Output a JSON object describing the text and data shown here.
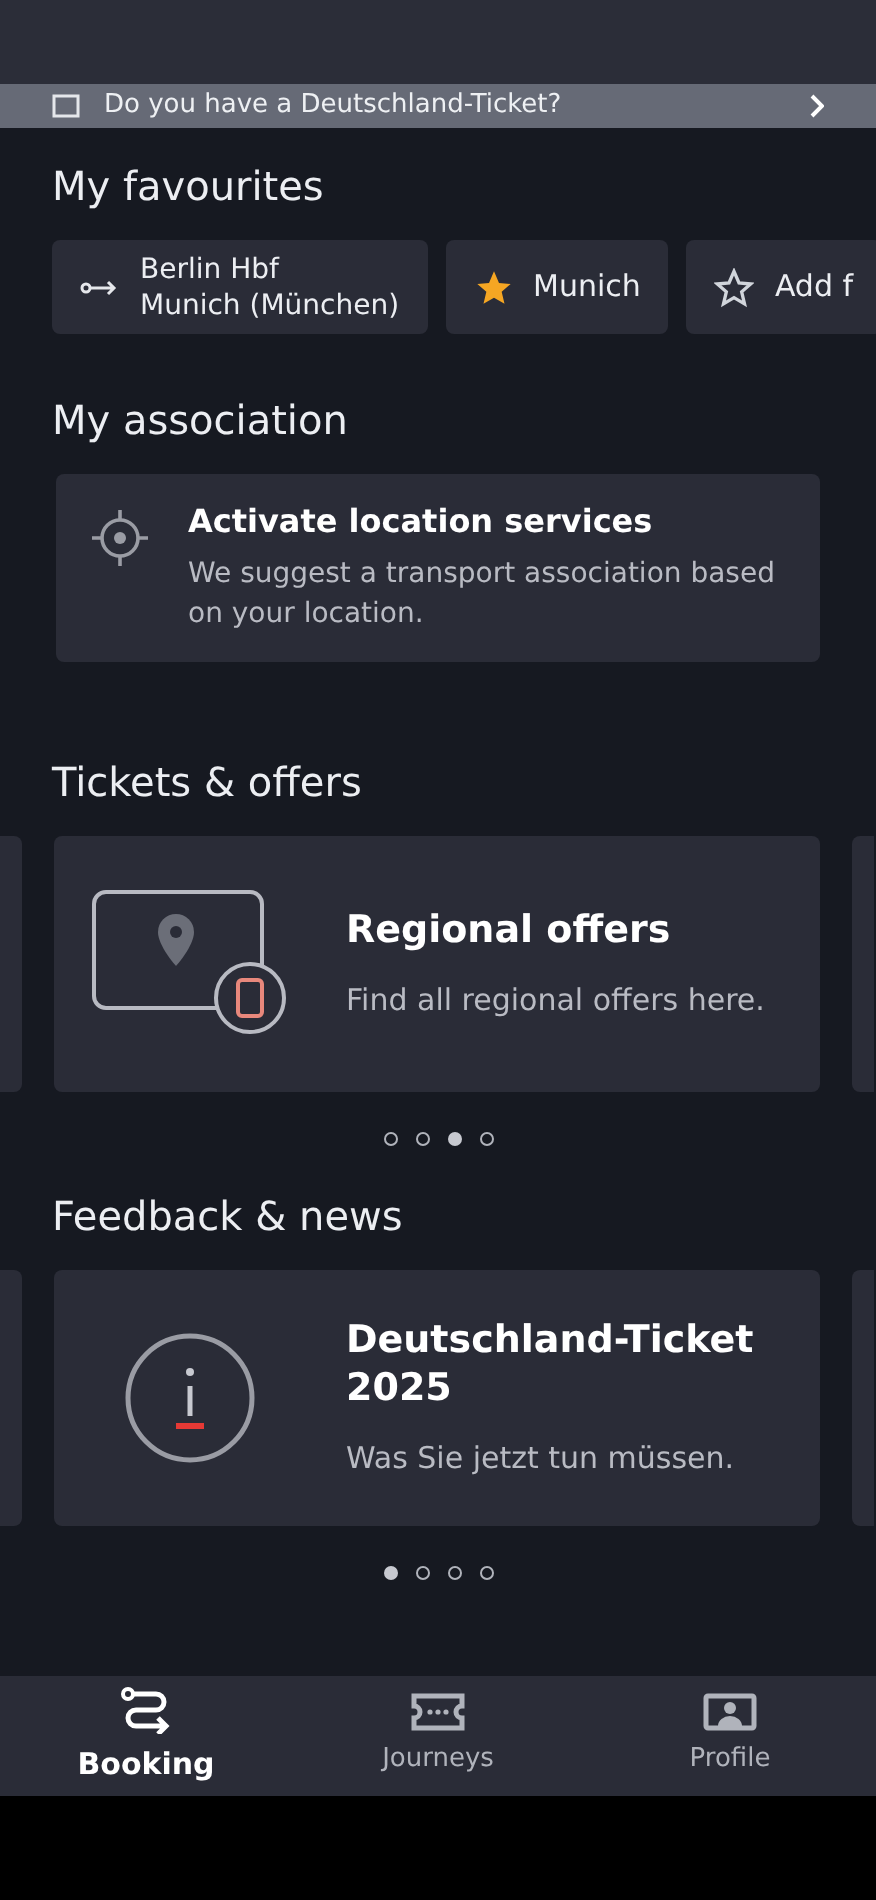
{
  "banner": {
    "text": "Do you have a Deutschland-Ticket?"
  },
  "favourites": {
    "title": "My favourites",
    "chips": [
      {
        "kind": "route",
        "from": "Berlin Hbf",
        "to": "Munich (München)"
      },
      {
        "kind": "starred",
        "label": "Munich"
      },
      {
        "kind": "add",
        "label": "Add f"
      }
    ]
  },
  "association": {
    "title": "My association",
    "card": {
      "title": "Activate location services",
      "text": "We suggest a transport association based on your location."
    }
  },
  "tickets": {
    "title": "Tickets & offers",
    "card": {
      "kind": "regional",
      "title": "Regional offers",
      "text": "Find all regional offers here."
    },
    "dots": [
      {
        "selected": false
      },
      {
        "selected": false
      },
      {
        "selected": true
      },
      {
        "selected": false
      }
    ]
  },
  "feedback": {
    "title": "Feedback & news",
    "card": {
      "kind": "info",
      "title": "Deutschland-Ticket 2025",
      "text": "Was Sie jetzt tun müssen."
    },
    "dots": [
      {
        "selected": true
      },
      {
        "selected": false
      },
      {
        "selected": false
      },
      {
        "selected": false
      }
    ]
  },
  "nav": [
    {
      "kind": "booking",
      "label": "Booking",
      "selected": true
    },
    {
      "kind": "journeys",
      "label": "Journeys",
      "selected": false
    },
    {
      "kind": "profile",
      "label": "Profile",
      "selected": false
    }
  ]
}
